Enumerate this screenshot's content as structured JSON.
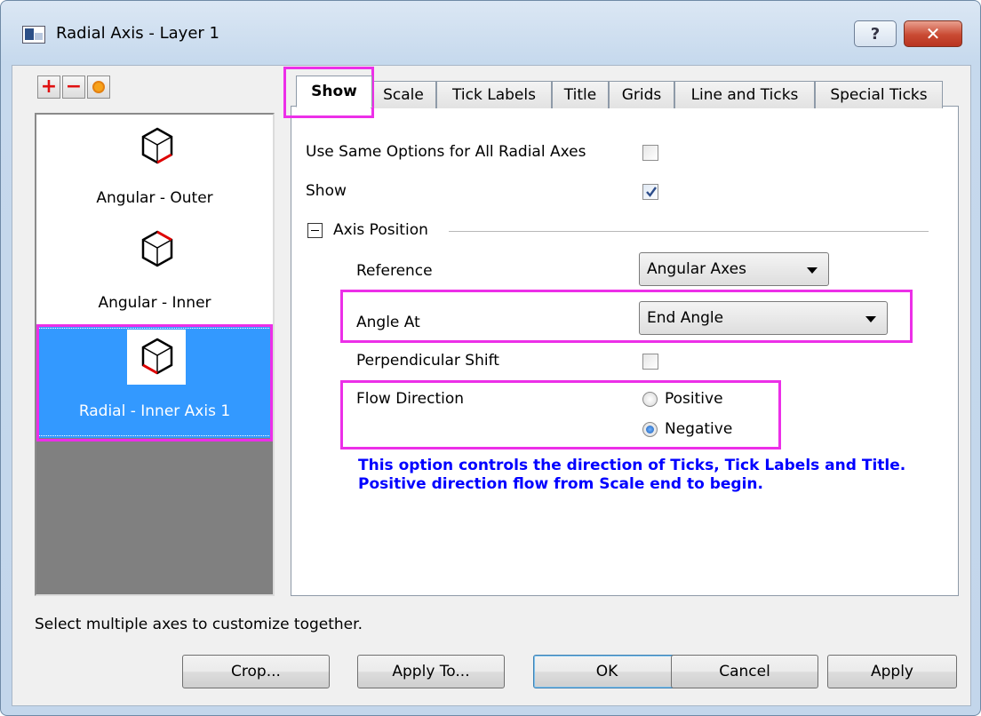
{
  "window": {
    "title": "Radial Axis - Layer 1",
    "help_glyph": "?",
    "close_glyph": "✕"
  },
  "toolbar": {
    "add_glyph": "+",
    "remove_glyph": "−"
  },
  "axes_list": {
    "items": [
      {
        "label": "Angular - Outer",
        "icon": "axis-cube-icon",
        "selected": false
      },
      {
        "label": "Angular - Inner",
        "icon": "axis-cube-icon",
        "selected": false
      },
      {
        "label": "Radial - Inner Axis 1",
        "icon": "axis-cube-icon",
        "selected": true
      }
    ]
  },
  "tabs": [
    {
      "label": "Show",
      "active": true
    },
    {
      "label": "Scale"
    },
    {
      "label": "Tick Labels"
    },
    {
      "label": "Title"
    },
    {
      "label": "Grids"
    },
    {
      "label": "Line and Ticks"
    },
    {
      "label": "Special Ticks"
    }
  ],
  "show_tab": {
    "same_options_label": "Use Same Options for All Radial Axes",
    "same_options_checked": false,
    "show_label": "Show",
    "show_checked": true,
    "axis_position_label": "Axis Position",
    "reference_label": "Reference",
    "reference_value": "Angular Axes",
    "angle_at_label": "Angle At",
    "angle_at_value": "End Angle",
    "perp_shift_label": "Perpendicular Shift",
    "perp_shift_checked": false,
    "flow_direction_label": "Flow Direction",
    "flow_positive_label": "Positive",
    "flow_negative_label": "Negative",
    "flow_selected": "Negative",
    "hint": "This option controls the direction of Ticks, Tick Labels and Title. Positive direction flow from Scale end to begin."
  },
  "status_text": "Select multiple axes to customize together.",
  "buttons": {
    "crop": "Crop...",
    "apply_to": "Apply To...",
    "ok": "OK",
    "cancel": "Cancel",
    "apply": "Apply"
  },
  "colors": {
    "highlight": "#ec2fe8",
    "selection": "#3399ff",
    "hint_text": "#0000ff"
  }
}
